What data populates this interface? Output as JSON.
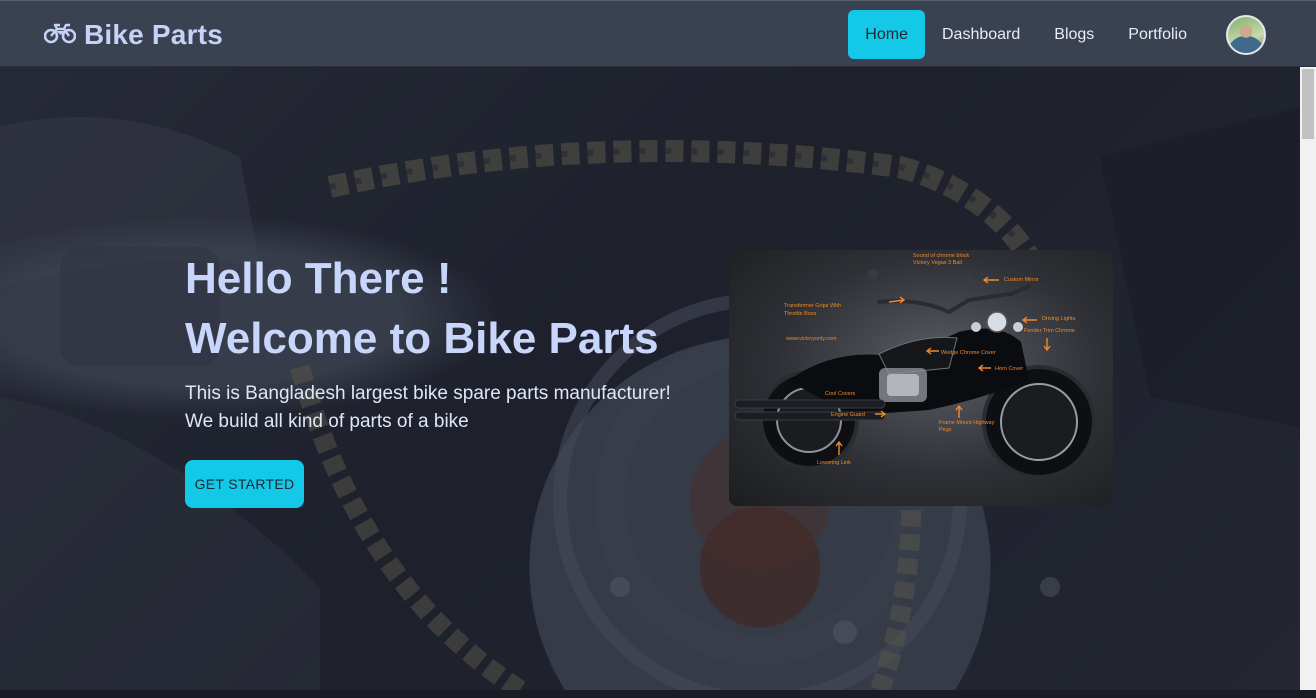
{
  "brand": {
    "name": "Bike Parts",
    "icon": "motorcycle-icon"
  },
  "nav": {
    "items": [
      {
        "label": "Home",
        "active": true
      },
      {
        "label": "Dashboard",
        "active": false
      },
      {
        "label": "Blogs",
        "active": false
      },
      {
        "label": "Portfolio",
        "active": false
      }
    ],
    "avatar": "user-avatar"
  },
  "hero": {
    "title_line1": "Hello There !",
    "title_line2": "Welcome to Bike Parts",
    "text_line1": "This is Bangladesh largest bike spare parts manufacturer!",
    "text_line2": "We build all kind of parts of a bike",
    "cta_label": "GET STARTED"
  },
  "bike_image": {
    "labels": [
      "Sound of chrome block",
      "Victory Vegas 3 Ball",
      "Custom Mirror",
      "Transformer Grips With",
      "Throttle Boss",
      "Driving Lights",
      "Fender Trim Chrome",
      "www.victoryonly.com",
      "Wedge Chrome Cover",
      "Horn Cover",
      "Cool Covers",
      "Engine Guard",
      "Frame Mount Highway",
      "Pegs",
      "Lowering Link"
    ]
  },
  "colors": {
    "accent": "#14c8e8",
    "navbar": "#3a4252",
    "brand_text": "#c5d3f7",
    "label_orange": "#f08a2a"
  }
}
